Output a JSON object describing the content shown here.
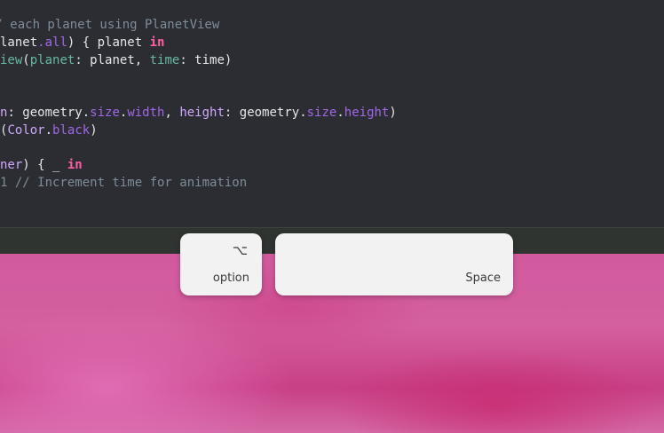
{
  "editor": {
    "lines": [
      [
        {
          "t": "// each planet using PlanetView",
          "c": "comment"
        }
      ],
      [
        {
          "t": "lanet",
          "c": "plain"
        },
        {
          "t": ".all",
          "c": "prop"
        },
        {
          "t": ") { planet ",
          "c": "plain"
        },
        {
          "t": "in",
          "c": "kw"
        }
      ],
      [
        {
          "t": "iew",
          "c": "fn"
        },
        {
          "t": "(",
          "c": "plain"
        },
        {
          "t": "planet",
          "c": "fn"
        },
        {
          "t": ": planet, ",
          "c": "plain"
        },
        {
          "t": "time",
          "c": "fn"
        },
        {
          "t": ": time)",
          "c": "plain"
        }
      ],
      [],
      [],
      [
        {
          "t": "n",
          "c": "type"
        },
        {
          "t": ": geometry.",
          "c": "plain"
        },
        {
          "t": "size",
          "c": "prop"
        },
        {
          "t": ".",
          "c": "plain"
        },
        {
          "t": "width",
          "c": "prop"
        },
        {
          "t": ", ",
          "c": "plain"
        },
        {
          "t": "height",
          "c": "type"
        },
        {
          "t": ": geometry.",
          "c": "plain"
        },
        {
          "t": "size",
          "c": "prop"
        },
        {
          "t": ".",
          "c": "plain"
        },
        {
          "t": "height",
          "c": "prop"
        },
        {
          "t": ")",
          "c": "plain"
        }
      ],
      [
        {
          "t": "(",
          "c": "plain"
        },
        {
          "t": "Color",
          "c": "type"
        },
        {
          "t": ".",
          "c": "plain"
        },
        {
          "t": "black",
          "c": "prop"
        },
        {
          "t": ")",
          "c": "plain"
        }
      ],
      [],
      [
        {
          "t": "ner",
          "c": "type"
        },
        {
          "t": ") { _ ",
          "c": "plain"
        },
        {
          "t": "in",
          "c": "kw"
        }
      ],
      [
        {
          "t": "1 // Increment time for animation",
          "c": "comment"
        }
      ]
    ]
  },
  "keys": {
    "option": {
      "symbol": "⌥",
      "label": "option"
    },
    "space": {
      "label": "Space"
    }
  }
}
